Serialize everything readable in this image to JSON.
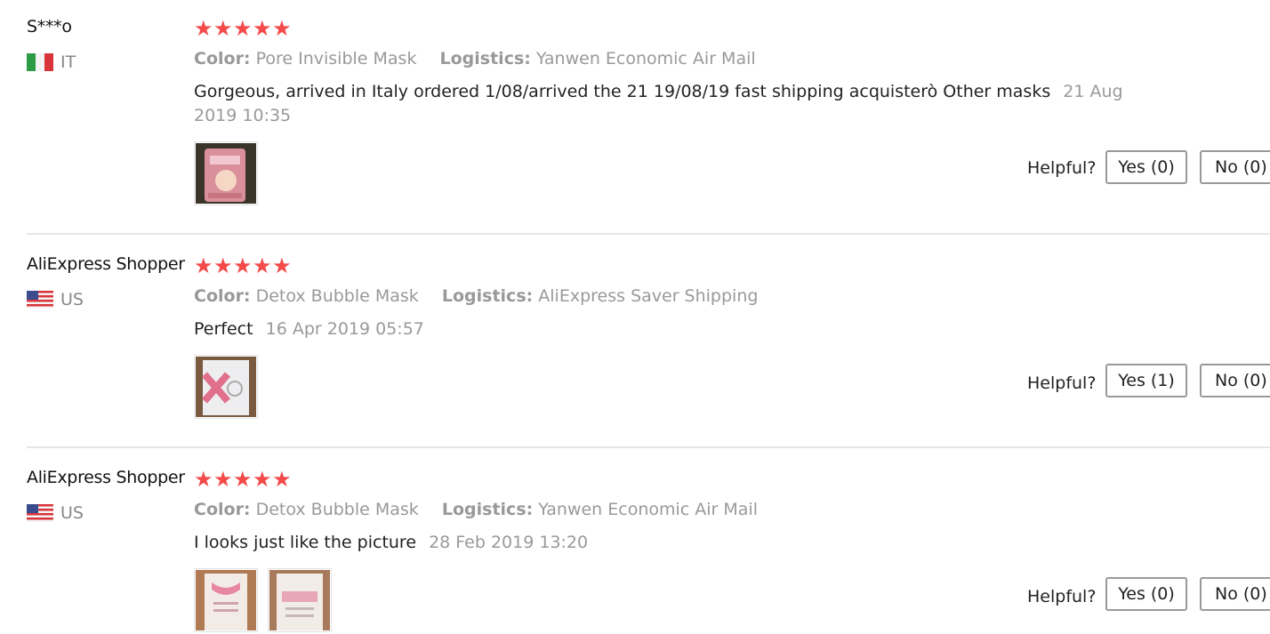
{
  "reviews": [
    {
      "user": "S***o",
      "country_code": "IT",
      "flag": "italy-flag",
      "stars": "★★★★★",
      "color_label": "Color:",
      "color_value": "Pore Invisible Mask",
      "logistics_label": "Logistics:",
      "logistics_value": "Yanwen Economic Air Mail",
      "text": "Gorgeous, arrived in Italy ordered 1/08/arrived the 21 19/08/19 fast shipping acquisterò Other masks",
      "date": "21 Aug 2019 10:35",
      "helpful_label": "Helpful?",
      "yes_label": "Yes (0)",
      "no_label": "No (0)"
    },
    {
      "user": "AliExpress Shopper",
      "country_code": "US",
      "flag": "usa-flag",
      "stars": "★★★★★",
      "color_label": "Color:",
      "color_value": "Detox Bubble Mask",
      "logistics_label": "Logistics:",
      "logistics_value": "AliExpress Saver Shipping",
      "text": "Perfect",
      "date": "16 Apr 2019 05:57",
      "helpful_label": "Helpful?",
      "yes_label": "Yes (1)",
      "no_label": "No (0)"
    },
    {
      "user": "AliExpress Shopper",
      "country_code": "US",
      "flag": "usa-flag",
      "stars": "★★★★★",
      "color_label": "Color:",
      "color_value": "Detox Bubble Mask",
      "logistics_label": "Logistics:",
      "logistics_value": "Yanwen Economic Air Mail",
      "text": "I looks just like the picture",
      "date": "28 Feb 2019 13:20",
      "helpful_label": "Helpful?",
      "yes_label": "Yes (0)",
      "no_label": "No (0)"
    }
  ],
  "colors": {
    "star": "#f44a4a",
    "meta_text": "#999999",
    "divider": "#e6e6e6",
    "button_border": "#999999"
  }
}
